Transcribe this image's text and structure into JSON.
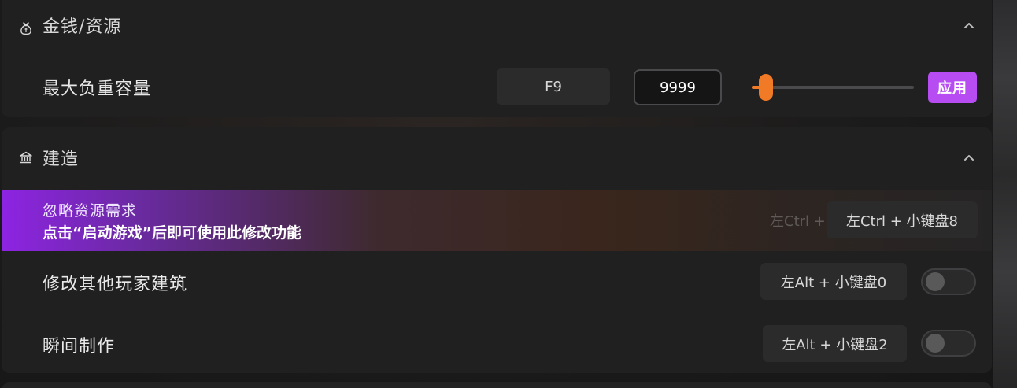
{
  "money_section": {
    "title": "金钱/资源",
    "icon": "money-bag-icon",
    "max_weight": {
      "label": "最大负重容量",
      "hotkey": "F9",
      "value": "9999",
      "slider_fraction": 0.03,
      "apply_label": "应用"
    }
  },
  "build_section": {
    "title": "建造",
    "icon": "building-icon",
    "rows": [
      {
        "label": "忽略资源需求",
        "note": "点击“启动游戏”后即可使用此修改功能",
        "hotkey": "左Ctrl + 小键盘8",
        "hotkey_ghost": "左Ctrl + 小键盘8"
      },
      {
        "label": "修改其他玩家建筑",
        "hotkey": "左Alt + 小键盘0",
        "toggle": false
      },
      {
        "label": "瞬间制作",
        "hotkey": "左Alt + 小键盘2",
        "toggle": false
      }
    ]
  },
  "colors": {
    "accent_orange": "#f07a26",
    "accent_purple": "#b64cf2",
    "highlight_purple": "#8d24e2"
  }
}
